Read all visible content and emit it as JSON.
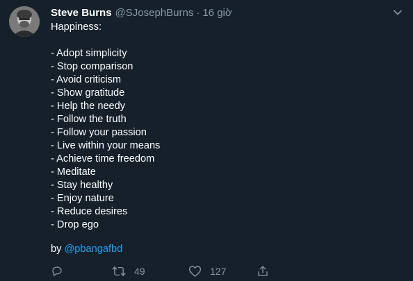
{
  "tweet": {
    "display_name": "Steve Burns",
    "handle": "@SJosephBurns",
    "separator": "·",
    "timestamp": "16 giờ",
    "intro": "Happiness:",
    "items": [
      "- Adopt simplicity",
      "- Stop comparison",
      "- Avoid criticism",
      "- Show gratitude",
      "- Help the needy",
      "- Follow the truth",
      "- Follow your passion",
      "- Live within your means",
      "- Achieve time freedom",
      "- Meditate",
      "- Stay healthy",
      "- Enjoy nature",
      "- Reduce desires",
      "- Drop ego"
    ],
    "byline_prefix": "by",
    "byline_mention": "@pbangafbd"
  },
  "actions": {
    "retweet_count": "49",
    "like_count": "127"
  },
  "icons": {
    "more": "chevron-down-icon",
    "reply": "reply-icon",
    "retweet": "retweet-icon",
    "like": "heart-icon",
    "share": "share-icon"
  },
  "colors": {
    "background": "#15202b",
    "text": "#ffffff",
    "secondary": "#8899a6",
    "link": "#1da1f2"
  }
}
